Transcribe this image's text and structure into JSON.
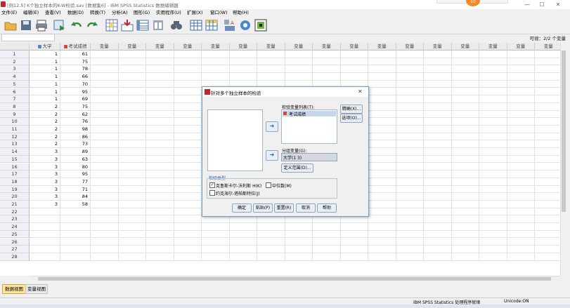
{
  "window": {
    "title": "[例12.5] K个独立样本的K-W检验.sav [数据集6] - IBM SPSS Statistics 数据编辑器",
    "badge_text": "10",
    "min": "—",
    "max": "☐",
    "close": "✕"
  },
  "menu": [
    "文件(E)",
    "编辑(E)",
    "查看(V)",
    "数据(D)",
    "转换(T)",
    "分析(A)",
    "图形(G)",
    "实用程序(U)",
    "扩展(X)",
    "窗口(W)",
    "帮助(H)"
  ],
  "vars_visible": "可视：2/2 个变量",
  "grid": {
    "columns": [
      "大学",
      "考试成绩",
      "变量",
      "变量",
      "变量",
      "变量",
      "变量",
      "变量",
      "变量",
      "变量",
      "变量",
      "变量",
      "变量",
      "变量",
      "变量",
      "变量",
      "变量",
      "变量",
      "变量",
      "变量"
    ],
    "rows": [
      [
        "1",
        "1",
        "61"
      ],
      [
        "2",
        "1",
        "75"
      ],
      [
        "3",
        "1",
        "78"
      ],
      [
        "4",
        "1",
        "66"
      ],
      [
        "5",
        "1",
        "70"
      ],
      [
        "6",
        "1",
        "95"
      ],
      [
        "7",
        "1",
        "69"
      ],
      [
        "8",
        "2",
        "75"
      ],
      [
        "9",
        "2",
        "62"
      ],
      [
        "10",
        "2",
        "76"
      ],
      [
        "11",
        "2",
        "98"
      ],
      [
        "12",
        "2",
        "86"
      ],
      [
        "13",
        "2",
        "73"
      ],
      [
        "14",
        "3",
        "89"
      ],
      [
        "15",
        "3",
        "63"
      ],
      [
        "16",
        "3",
        "80"
      ],
      [
        "17",
        "3",
        "95"
      ],
      [
        "18",
        "3",
        "77"
      ],
      [
        "19",
        "3",
        "71"
      ],
      [
        "20",
        "3",
        "84"
      ],
      [
        "21",
        "3",
        "58"
      ],
      [
        "22",
        "",
        ""
      ],
      [
        "23",
        "",
        ""
      ],
      [
        "24",
        "",
        ""
      ],
      [
        "25",
        "",
        ""
      ],
      [
        "26",
        "",
        ""
      ],
      [
        "27",
        "",
        ""
      ],
      [
        "28",
        "",
        ""
      ]
    ]
  },
  "tabs": {
    "data_view": "数据视图",
    "variable_view": "变量视图"
  },
  "status": {
    "processor": "IBM SPSS Statistics 处理程序就绪",
    "unicode": "Unicode:ON"
  },
  "dialog": {
    "title": "针对多个独立样本的检验",
    "test_var_label": "检验变量列表(T):",
    "test_var_item": "考试成绩",
    "group_var_label": "分组变量(G):",
    "group_var_value": "大学(1 3)",
    "define_range": "定义范围(D)...",
    "exact": "精确(X)...",
    "options": "选项(O)...",
    "test_type_label": "检验类型",
    "kw_label": "克鲁斯卡尔-沃利斯 H(K)",
    "kw_checked": true,
    "median_label": "中位数(M)",
    "jt_label": "约克海尔-塔帕斯特拉(J)",
    "ok": "确定",
    "paste": "粘贴(P)",
    "reset": "重置(R)",
    "cancel": "取消",
    "help": "帮助"
  }
}
